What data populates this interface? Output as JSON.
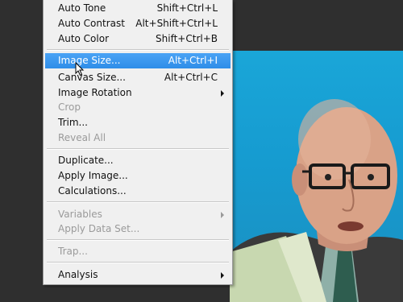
{
  "menu": {
    "items": [
      {
        "label": "Auto Tone",
        "shortcut": "Shift+Ctrl+L"
      },
      {
        "label": "Auto Contrast",
        "shortcut": "Alt+Shift+Ctrl+L"
      },
      {
        "label": "Auto Color",
        "shortcut": "Shift+Ctrl+B"
      },
      {
        "label": "Image Size...",
        "shortcut": "Alt+Ctrl+I"
      },
      {
        "label": "Canvas Size...",
        "shortcut": "Alt+Ctrl+C"
      },
      {
        "label": "Image Rotation",
        "shortcut": ""
      },
      {
        "label": "Crop",
        "shortcut": ""
      },
      {
        "label": "Trim...",
        "shortcut": ""
      },
      {
        "label": "Reveal All",
        "shortcut": ""
      },
      {
        "label": "Duplicate...",
        "shortcut": ""
      },
      {
        "label": "Apply Image...",
        "shortcut": ""
      },
      {
        "label": "Calculations...",
        "shortcut": ""
      },
      {
        "label": "Variables",
        "shortcut": ""
      },
      {
        "label": "Apply Data Set...",
        "shortcut": ""
      },
      {
        "label": "Trap...",
        "shortcut": ""
      },
      {
        "label": "Analysis",
        "shortcut": ""
      }
    ]
  },
  "colors": {
    "highlight": "#3399ff",
    "menu_bg": "#f0f0f0",
    "workspace_bg": "#2f2f2f",
    "photo_bg": "#1aa6d8"
  }
}
